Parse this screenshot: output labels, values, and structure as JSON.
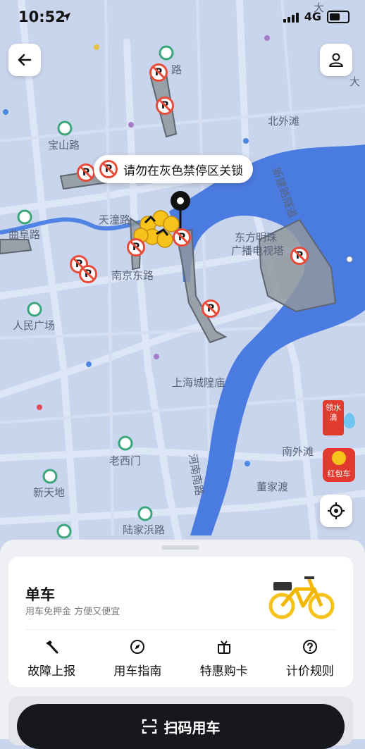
{
  "status": {
    "time": "10:52",
    "network": "4G"
  },
  "map": {
    "toast": "请勿在灰色禁停区关锁",
    "labels": [
      "路",
      "宝山路",
      "天潼路",
      "曲阜路",
      "南京东路",
      "人民广场",
      "北外滩",
      "新建路隧道",
      "东方明珠",
      "广播电视塔",
      "上海城隍庙",
      "老西门",
      "河南南路",
      "新天地",
      "陆家浜路",
      "董家渡",
      "南外滩",
      "大",
      "大"
    ],
    "no_parking_marker": "P",
    "redpack_water": "领水滴",
    "redpack_bike": "红包车"
  },
  "sheet": {
    "title": "单车",
    "subtitle": "用车免押金 方便又便宜",
    "actions": [
      {
        "label": "故障上报",
        "icon": "hammer-icon"
      },
      {
        "label": "用车指南",
        "icon": "compass-icon"
      },
      {
        "label": "特惠购卡",
        "icon": "card-gift-icon"
      },
      {
        "label": "计价规则",
        "icon": "question-icon"
      }
    ],
    "scan_label": "扫码用车"
  },
  "colors": {
    "map_bg": "#c9d5ec",
    "water": "#4a7be0",
    "zone": "#8d949e",
    "accent_red": "#e84b3a",
    "bike_yellow": "#f7c21b"
  }
}
